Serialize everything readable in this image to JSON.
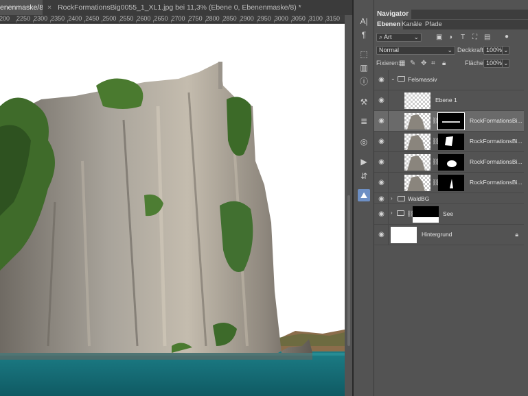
{
  "tabs": {
    "active_label": "enenmaske/8) *",
    "second_close": "×",
    "second_label": "RockFormationsBig0055_1_XL1.jpg bei 11,3% (Ebene 0, Ebenenmaske/8) *"
  },
  "ruler": {
    "ticks": [
      "200",
      "2250",
      "2300",
      "2350",
      "2400",
      "2450",
      "2500",
      "2550",
      "2600",
      "2650",
      "2700",
      "2750",
      "2800",
      "2850",
      "2900",
      "2950",
      "3000",
      "3050",
      "3100",
      "3150"
    ]
  },
  "tools": [
    "A|",
    "¶",
    "⬚",
    "▥",
    "ⓘ",
    "⚒",
    "≣",
    "◎",
    "▶",
    "⇵",
    "⛰"
  ],
  "panel": {
    "navigator_tab": "Navigator",
    "layer_tabs": [
      "Ebenen",
      "Kanäle",
      "Pfade"
    ],
    "filter_value": "Art",
    "blend_mode": "Normal",
    "opacity_label": "Deckkraft:",
    "opacity_value": "100%",
    "lock_label": "Fixieren:",
    "fill_label": "Fläche:",
    "fill_value": "100%"
  },
  "layers": [
    {
      "name": "Felsmassiv",
      "kind": "group-open"
    },
    {
      "name": "Ebene 1",
      "kind": "pixel"
    },
    {
      "name": "RockFormationsBi...",
      "kind": "masked",
      "selected": true
    },
    {
      "name": "RockFormationsBi...",
      "kind": "masked"
    },
    {
      "name": "RockFormationsBi...",
      "kind": "masked"
    },
    {
      "name": "RockFormationsBi...",
      "kind": "masked"
    },
    {
      "name": "WaldBG",
      "kind": "group-closed"
    },
    {
      "name": "See",
      "kind": "group-closed-mask"
    },
    {
      "name": "Hintergrund",
      "kind": "background"
    }
  ],
  "colors": {
    "accent": "#6d8fc4",
    "panel_bg": "#535353",
    "tab_bg": "#3b3b3b",
    "water": "#1d6f76"
  }
}
